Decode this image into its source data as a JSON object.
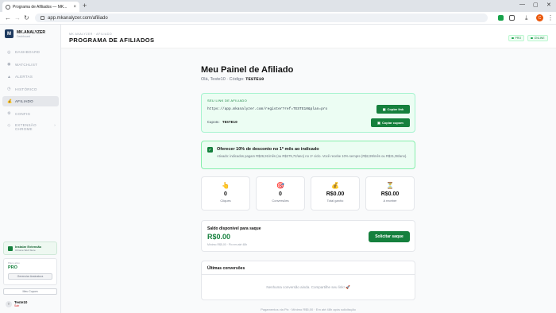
{
  "browser": {
    "tab_title": "Programa de Afiliados — MK...",
    "url": "app.mkanalyzer.com/afiliado",
    "profile_initial": "C"
  },
  "sidebar": {
    "logo_letter": "M",
    "brand": "MK.ANALYZER",
    "brand_sub": "Dashboard",
    "items": [
      {
        "label": "DASHBOARD",
        "icon": "grid-icon"
      },
      {
        "label": "WATCHLIST",
        "icon": "eye-icon"
      },
      {
        "label": "ALERTAS",
        "icon": "triangle-icon"
      },
      {
        "label": "HISTÓRICO",
        "icon": "clock-icon"
      },
      {
        "label": "AFILIADO",
        "icon": "money-bag-icon"
      },
      {
        "label": "CONFIG",
        "icon": "gear-icon"
      },
      {
        "label": "EXTENSÃO",
        "label2": "CHROME",
        "icon": "puzzle-icon"
      }
    ],
    "ext_card": {
      "title": "Instalar Extensão",
      "sub": "Chrome Web Store"
    },
    "plan": {
      "label": "Plano ativo",
      "value": "PRO",
      "manage": "Gerenciar Assinatura"
    },
    "coupon_button": "Meu Cupom",
    "user": {
      "name": "Teste10",
      "action": "Sair",
      "initial": "T"
    }
  },
  "header": {
    "eyebrow": "MK ANALYZER · AFILIADO",
    "title": "PROGRAMA DE AFILIADOS",
    "badge_pro": "PRO",
    "badge_online": "ONLINE"
  },
  "panel": {
    "title": "Meu Painel de Afiliado",
    "greeting": "Olá, Teste10",
    "code_label": "Código:",
    "code": "TESTE10"
  },
  "link_card": {
    "label": "SEU LINK DE AFILIADO",
    "url": "https://app.mkanalyzer.com/register?ref=TESTE10&plan=pro",
    "copy_link": "Copiar link",
    "coupon_label": "Cupom:",
    "coupon": "TESTE10",
    "copy_coupon": "Copiar cupom"
  },
  "offer": {
    "checked": true,
    "title": "Oferecer 10% de desconto no 1º mês ao indicado",
    "desc": "Ativado: indicados pagam R$26,91/mês (ou R$279,72/ano) no 1º ciclo. Você recebe 10% sempre (R$2,99/mês ou R$31,08/ano)."
  },
  "stats": [
    {
      "icon": "pointer-hand-icon",
      "glyph": "👆",
      "value": "0",
      "label": "Cliques"
    },
    {
      "icon": "target-icon",
      "glyph": "🎯",
      "value": "0",
      "label": "Conversões"
    },
    {
      "icon": "money-bag-icon",
      "glyph": "💰",
      "value": "R$0.00",
      "label": "Total ganho"
    },
    {
      "icon": "hourglass-icon",
      "glyph": "⏳",
      "value": "R$0.00",
      "label": "A receber"
    }
  ],
  "saldo": {
    "title": "Saldo disponível para saque",
    "value": "R$0.00",
    "sub": "Mínimo R$5,00 · Pix em até 48h",
    "button": "Solicitar saque"
  },
  "conversions": {
    "title": "Últimas conversões",
    "empty": "Nenhuma conversão ainda. Compartilhe seu link! 🚀"
  },
  "footer": "Pagamentos via Pix · Mínimo R$5,00 · Em até 48h após solicitação"
}
